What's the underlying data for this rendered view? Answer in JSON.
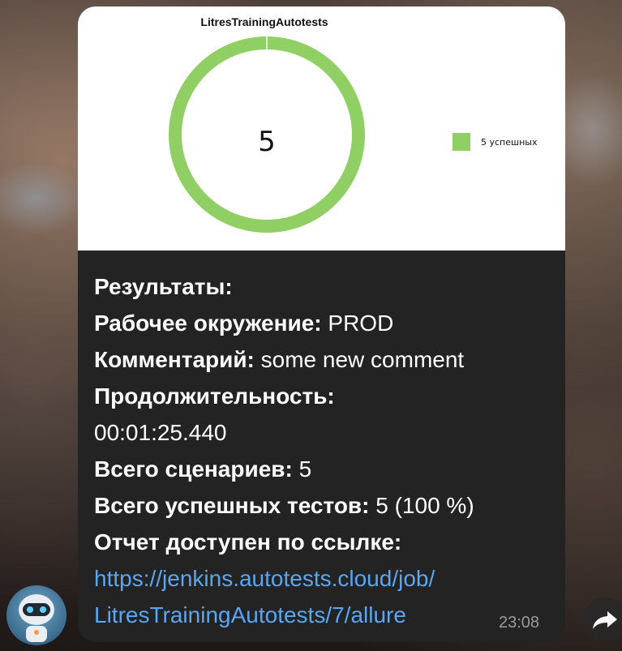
{
  "chart_data": {
    "type": "pie",
    "title": "LitresTrainingAutotests",
    "center_label": "5",
    "categories": [
      "5 успешных"
    ],
    "values": [
      5
    ],
    "legend_position": "right",
    "colors": [
      "#8fcf63"
    ]
  },
  "message": {
    "results_label": "Результаты:",
    "environment_label": "Рабочее окружение:",
    "environment_value": "PROD",
    "comment_label": "Комментарий:",
    "comment_value": "some new comment",
    "duration_label": "Продолжительность:",
    "duration_value": "00:01:25.440",
    "scenarios_label": "Всего сценариев:",
    "scenarios_value": "5",
    "passed_label": "Всего успешных тестов:",
    "passed_value": "5 (100 %)",
    "report_label": "Отчет доступен по ссылке:",
    "link_line1": "https://jenkins.autotests.cloud/job/",
    "link_line2": "LitresTrainingAutotests/7/allure",
    "time": "23:08"
  },
  "icons": {
    "avatar": "robot-avatar-icon",
    "share": "share-arrow-icon"
  }
}
